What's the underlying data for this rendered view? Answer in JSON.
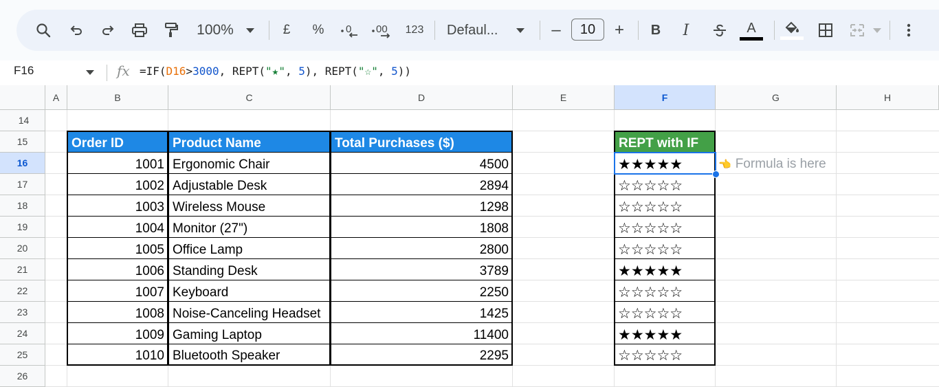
{
  "toolbar": {
    "zoom": "100%",
    "currency": "£",
    "percent": "%",
    "number_format": "123",
    "font_family": "Defaul...",
    "font_size": "10",
    "font_size_minus": "–",
    "font_size_plus": "+",
    "bold": "B",
    "italic": "I",
    "text_color_letter": "A",
    "icons": [
      "search-icon",
      "undo-icon",
      "redo-icon",
      "print-icon",
      "paint-format-icon",
      "decrease-decimal-icon",
      "increase-decimal-icon",
      "strikethrough-icon",
      "text-color-icon",
      "fill-color-icon",
      "borders-icon",
      "merge-cells-icon",
      "more-vert-icon"
    ]
  },
  "formula_bar": {
    "name_box": "F16",
    "fx": "fx",
    "formula_parts": [
      "=IF(",
      "D16",
      ">",
      "3000",
      ", REPT(",
      "\"★\"",
      ", ",
      "5",
      "), REPT(",
      "\"☆\"",
      ", ",
      "5",
      "))"
    ]
  },
  "grid": {
    "columns": [
      "A",
      "B",
      "C",
      "D",
      "E",
      "F",
      "G",
      "H"
    ],
    "selected_column": "F",
    "rows": [
      "14",
      "15",
      "16",
      "17",
      "18",
      "19",
      "20",
      "21",
      "22",
      "23",
      "24",
      "25",
      "26"
    ],
    "selected_row": "16",
    "headers": {
      "order_id": "Order ID",
      "product_name": "Product Name",
      "total_purchases": "Total Purchases ($)",
      "rept_with_if": "REPT with IF"
    },
    "data": [
      {
        "id": "1001",
        "product": "Ergonomic Chair",
        "total": "4500",
        "stars": "★★★★★"
      },
      {
        "id": "1002",
        "product": "Adjustable Desk",
        "total": "2894",
        "stars": "☆☆☆☆☆"
      },
      {
        "id": "1003",
        "product": "Wireless Mouse",
        "total": "1298",
        "stars": "☆☆☆☆☆"
      },
      {
        "id": "1004",
        "product": "Monitor (27\")",
        "total": "1808",
        "stars": "☆☆☆☆☆"
      },
      {
        "id": "1005",
        "product": "Office Lamp",
        "total": "2800",
        "stars": "☆☆☆☆☆"
      },
      {
        "id": "1006",
        "product": "Standing Desk",
        "total": "3789",
        "stars": "★★★★★"
      },
      {
        "id": "1007",
        "product": "Keyboard",
        "total": "2250",
        "stars": "☆☆☆☆☆"
      },
      {
        "id": "1008",
        "product": "Noise-Canceling Headset",
        "total": "1425",
        "stars": "☆☆☆☆☆"
      },
      {
        "id": "1009",
        "product": "Gaming Laptop",
        "total": "11400",
        "stars": "★★★★★"
      },
      {
        "id": "1010",
        "product": "Bluetooth Speaker",
        "total": "2295",
        "stars": "☆☆☆☆☆"
      }
    ],
    "note": {
      "icon": "👈",
      "text": "Formula is here"
    }
  },
  "colors": {
    "header_blue": "#1e88e5",
    "header_green": "#43a047",
    "selection": "#1a73e8"
  }
}
